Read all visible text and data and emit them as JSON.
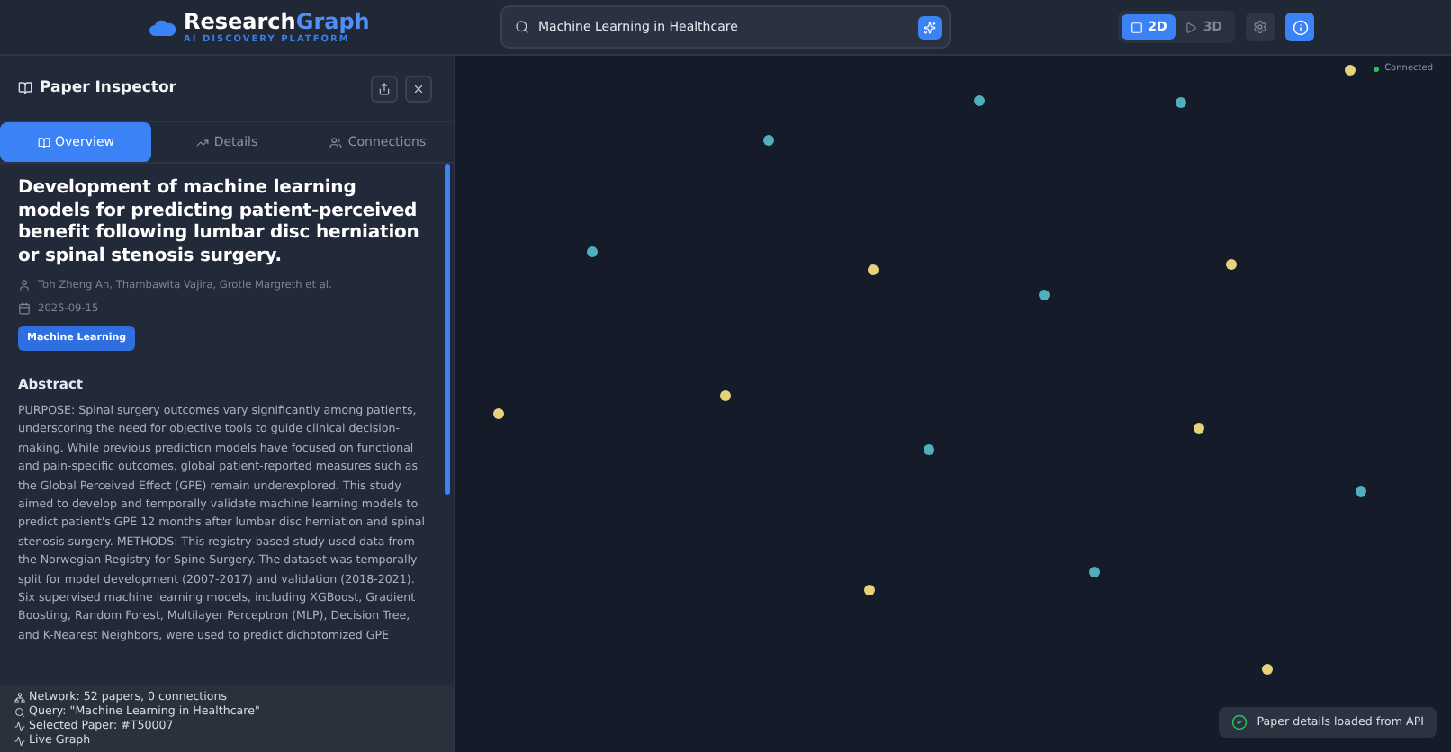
{
  "header": {
    "brand": "Research",
    "brand_accent": "Graph",
    "tagline": "AI DISCOVERY PLATFORM",
    "search": {
      "value": "Machine Learning in Healthcare"
    },
    "view_modes": [
      {
        "label": "2D",
        "selected": true
      },
      {
        "label": "3D",
        "selected": false
      }
    ]
  },
  "inspector": {
    "title": "Paper Inspector",
    "tabs": [
      {
        "label": "Overview",
        "selected": true
      },
      {
        "label": "Details",
        "selected": false
      },
      {
        "label": "Connections",
        "selected": false
      }
    ],
    "paper": {
      "title": "Development of machine learning models for predicting patient-perceived benefit following lumbar disc herniation or spinal stenosis surgery.",
      "authors": "Toh Zheng An, Thambawita Vajira, Grotle Margreth et al.",
      "date": "2025-09-15",
      "tags": [
        "Machine Learning"
      ],
      "abstract_heading": "Abstract",
      "abstract": "PURPOSE: Spinal surgery outcomes vary significantly among patients, underscoring the need for objective tools to guide clinical decision-making. While previous prediction models have focused on functional and pain-specific outcomes, global patient-reported measures such as the Global Perceived Effect (GPE) remain underexplored. This study aimed to develop and temporally validate machine learning models to predict patient's GPE 12 months after lumbar disc herniation and spinal stenosis surgery. METHODS: This registry-based study used data from the Norwegian Registry for Spine Surgery. The dataset was temporally split for model development (2007-2017) and validation (2018-2021). Six supervised machine learning models, including XGBoost, Gradient Boosting, Random Forest, Multilayer Perceptron (MLP), Decision Tree, and K-Nearest Neighbors, were used to predict dichotomized GPE"
    }
  },
  "status": [
    "Network: 52 papers, 0 connections",
    "Query: \"Machine Learning in Healthcare\"",
    "Selected Paper: #T50007",
    "Live Graph"
  ],
  "connection": {
    "label": "Connected",
    "on": true
  },
  "toast": "Paper details loaded from API"
}
